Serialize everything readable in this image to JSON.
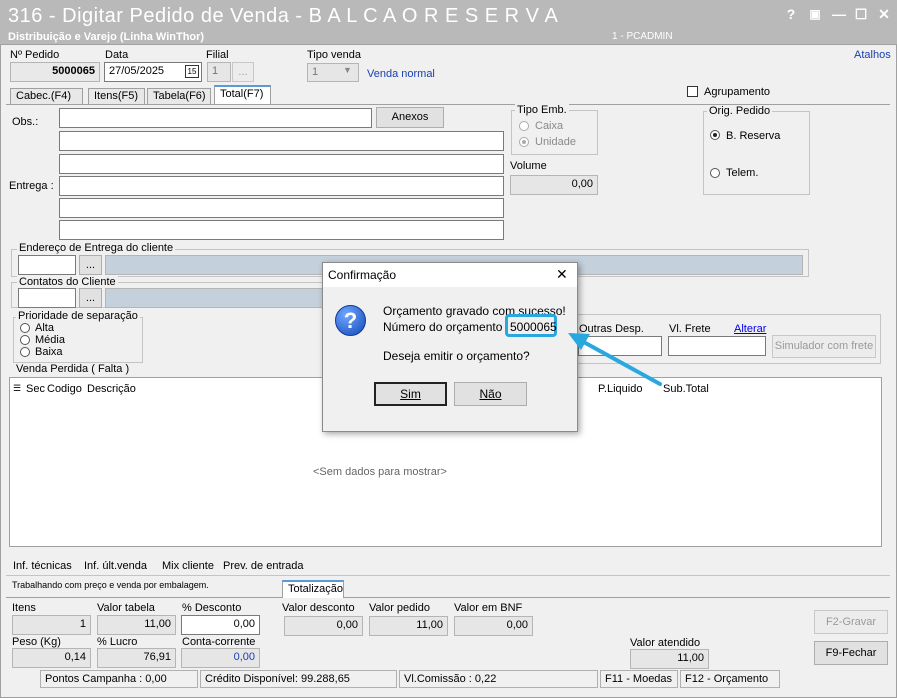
{
  "window": {
    "title": "316 - Digitar Pedido de Venda - B A L C A O   R E S E R V A",
    "subtitle": "Distribuição e Varejo (Linha WinThor)",
    "user": "1 - PCADMIN",
    "controls": [
      "?",
      "▣",
      "—",
      "☐",
      "✕"
    ]
  },
  "header": {
    "pedido_label": "Nº Pedido",
    "pedido_value": "5000065",
    "data_label": "Data",
    "data_value": "27/05/2025",
    "calendar_icon": "15",
    "filial_label": "Filial",
    "filial_value": "1",
    "filial_btn": "...",
    "tipo_venda_label": "Tipo venda",
    "tipo_venda_value": "1",
    "tipo_venda_desc": "Venda normal",
    "atalhos": "Atalhos",
    "agrupamento": "Agrupamento"
  },
  "tabs": [
    "Cabec.(F4)",
    "Itens(F5)",
    "Tabela(F6)",
    "Total(F7)"
  ],
  "form": {
    "obs_label": "Obs.:",
    "anexos_btn": "Anexos",
    "entrega_label": "Entrega :",
    "tipo_emb_label": "Tipo Emb.",
    "caixa": "Caixa",
    "unidade": "Unidade",
    "volume_label": "Volume",
    "volume_value": "0,00",
    "orig_pedido_label": "Orig. Pedido",
    "b_reserva": "B. Reserva",
    "telem": "Telem.",
    "endereco_label": "Endereço de Entrega do cliente",
    "contatos_label": "Contatos do Cliente",
    "dots": "...",
    "prioridade_label": "Prioridade de separação",
    "alta": "Alta",
    "media": "Média",
    "baixa": "Baixa",
    "outras_desp": "Outras Desp.",
    "vl_frete": "Vl. Frete",
    "alterar": "Alterar",
    "simulador_btn": "Simulador com frete"
  },
  "grid": {
    "title": "Venda Perdida ( Falta )",
    "columns": [
      "Sec",
      "Codigo",
      "Descrição",
      "P.Liquido",
      "Sub.Total"
    ],
    "empty": "<Sem dados para mostrar>"
  },
  "bottom_links": [
    "Inf. técnicas",
    "Inf. últ.venda",
    "Mix cliente",
    "Prev. de entrada"
  ],
  "info_text": "Trabalhando com preço e venda por embalagem.",
  "totalizacao_tab": "Totalização",
  "totals": {
    "itens_label": "Itens",
    "itens_value": "1",
    "valor_tabela_label": "Valor tabela",
    "valor_tabela_value": "11,00",
    "pct_desconto_label": "% Desconto",
    "pct_desconto_value": "0,00",
    "valor_desconto_label": "Valor desconto",
    "valor_desconto_value": "0,00",
    "valor_pedido_label": "Valor pedido",
    "valor_pedido_value": "11,00",
    "valor_bnf_label": "Valor em BNF",
    "valor_bnf_value": "0,00",
    "peso_label": "Peso (Kg)",
    "peso_value": "0,14",
    "pct_lucro_label": "% Lucro",
    "pct_lucro_value": "76,91",
    "conta_corrente_label": "Conta-corrente",
    "conta_corrente_value": "0,00",
    "valor_atendido_label": "Valor atendido",
    "valor_atendido_value": "11,00"
  },
  "actions": {
    "gravar": "F2-Gravar",
    "fechar": "F9-Fechar"
  },
  "statusbar": [
    "Pontos Campanha : 0,00",
    "Crédito Disponível: 99.288,65",
    "Vl.Comissão : 0,22",
    "F11 - Moedas",
    "F12 - Orçamento"
  ],
  "dialog": {
    "title": "Confirmação",
    "close": "✕",
    "line1": "Orçamento gravado com sucesso!",
    "line2_prefix": "Número do orçamento",
    "number": "5000065",
    "question": "Deseja emitir o orçamento?",
    "yes": "Sim",
    "no": "Não",
    "accent": "#29a8e0"
  }
}
